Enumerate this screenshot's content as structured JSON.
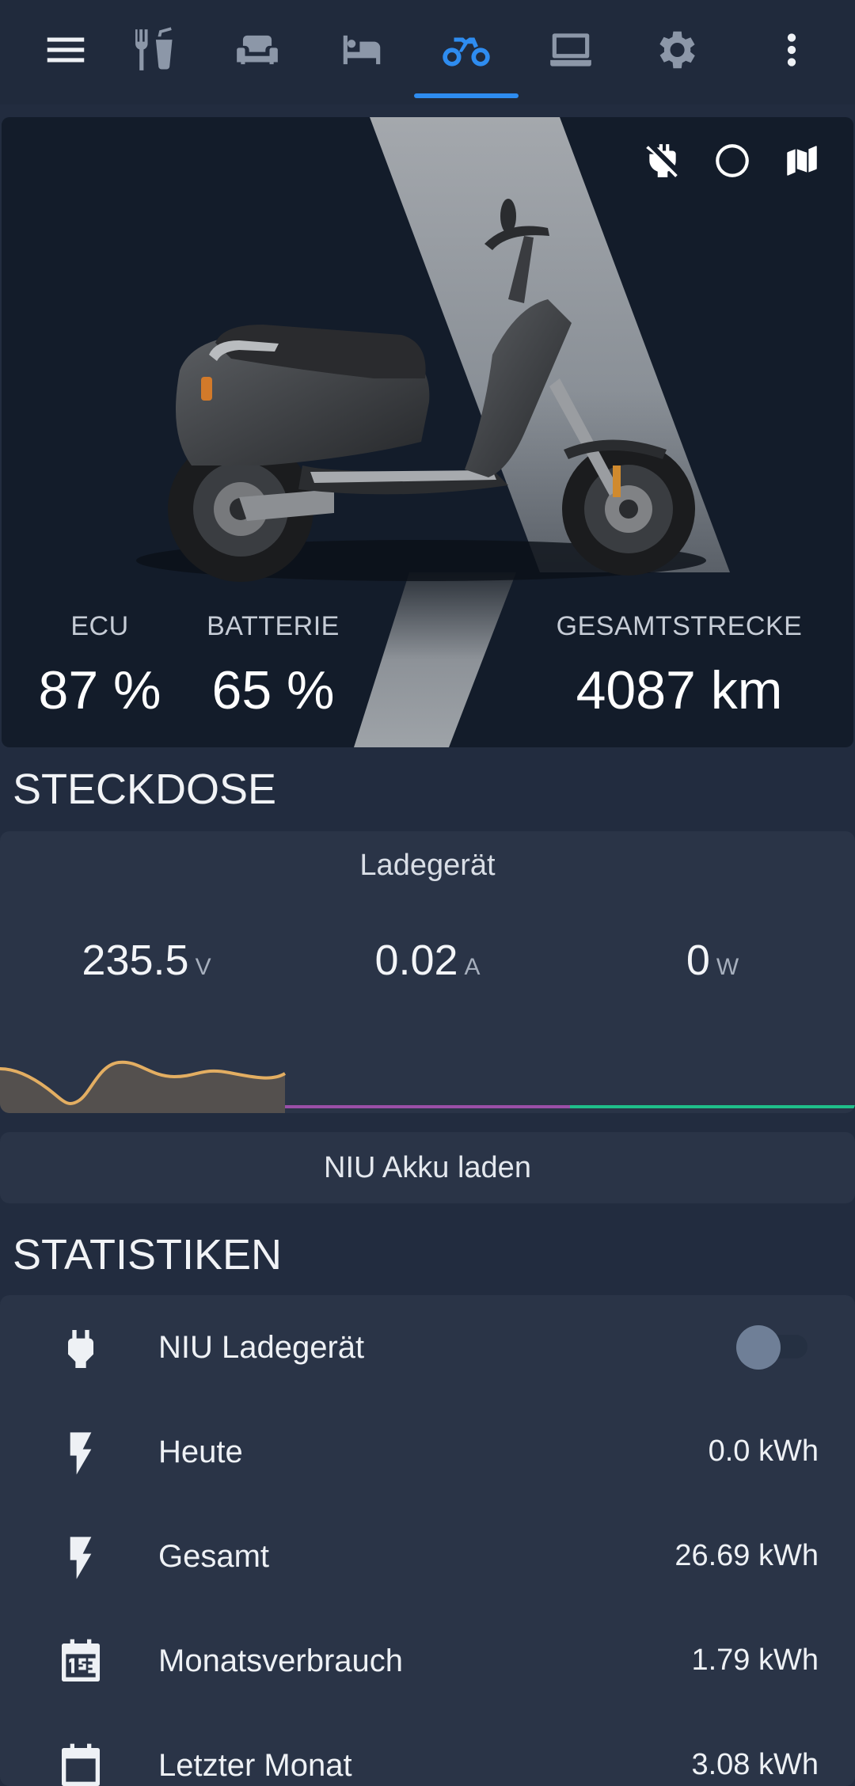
{
  "tabs": [
    {
      "icon": "menu-icon"
    },
    {
      "icon": "dining-icon"
    },
    {
      "icon": "sofa-icon"
    },
    {
      "icon": "bed-icon"
    },
    {
      "icon": "motorbike-icon",
      "active": true
    },
    {
      "icon": "laptop-icon"
    },
    {
      "icon": "gear-icon"
    },
    {
      "icon": "more-vertical-icon"
    }
  ],
  "colors": {
    "accent": "#2e8cf0",
    "background": "#222c3f",
    "card": "#2a3447"
  },
  "hero": {
    "actions": [
      "power-plug-off-icon",
      "circle-outline-icon",
      "map-icon"
    ],
    "ecu": {
      "label": "ECU",
      "value": "87 %"
    },
    "battery": {
      "label": "BATTERIE",
      "value": "65 %"
    },
    "mileage": {
      "label": "GESAMTSTRECKE",
      "value": "4087 km"
    }
  },
  "socket": {
    "section_title": "STECKDOSE",
    "name": "Ladegerät",
    "voltage": {
      "value": "235.5",
      "unit": "V"
    },
    "current": {
      "value": "0.02",
      "unit": "A"
    },
    "power": {
      "value": "0",
      "unit": "W"
    },
    "charge_button": "NIU Akku laden"
  },
  "stats": {
    "section_title": "STATISTIKEN",
    "rows": [
      {
        "icon": "power-plug-icon",
        "name": "NIU Ladegerät",
        "toggle": false
      },
      {
        "icon": "flash-icon",
        "name": "Heute",
        "value": "0.0 kWh"
      },
      {
        "icon": "flash-icon",
        "name": "Gesamt",
        "value": "26.69 kWh"
      },
      {
        "icon": "calendar-month-icon",
        "name": "Monatsverbrauch",
        "value": "1.79 kWh"
      },
      {
        "icon": "calendar-month-icon",
        "name": "Letzter Monat",
        "value": "3.08 kWh"
      }
    ]
  }
}
